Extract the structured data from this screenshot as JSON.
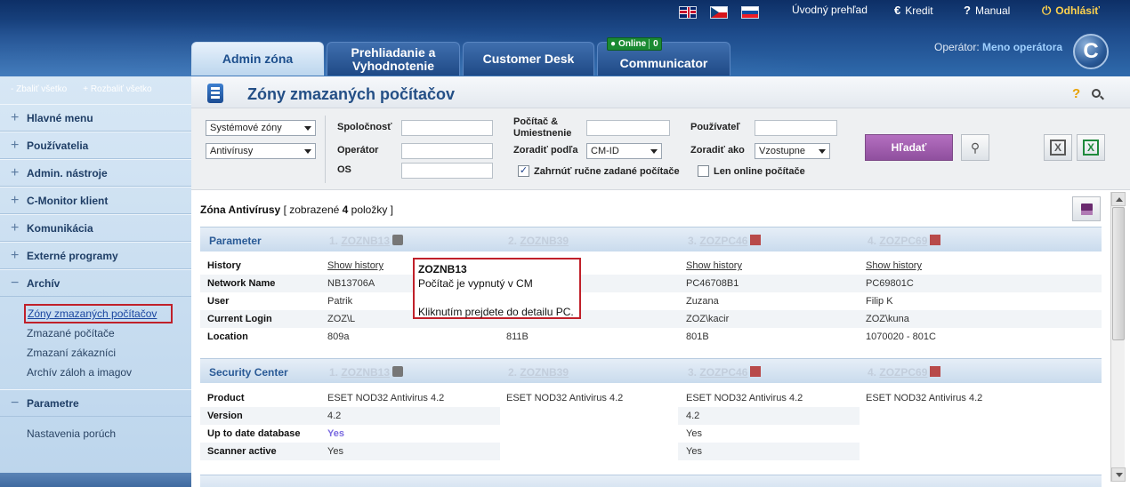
{
  "topbar": {
    "links": [
      {
        "icon": "",
        "label": "Úvodný prehľad"
      },
      {
        "icon": "€",
        "label": "Kredit"
      },
      {
        "icon": "?",
        "label": "Manual"
      },
      {
        "icon": "⏻",
        "label": "Odhlásiť"
      }
    ],
    "tabs": [
      "Admin zóna",
      "Prehliadanie a Vyhodnotenie",
      "Customer Desk",
      "Communicator"
    ],
    "online_label": "Online",
    "online_count": "0",
    "operator_label": "Operátor:",
    "operator_name": "Meno operátora",
    "logo_letter": "C"
  },
  "sidebar": {
    "collapse_all": "- Zbaliť všetko",
    "expand_all": "+ Rozbaliť všetko",
    "items": [
      {
        "sign": "+",
        "label": "Hlavné menu"
      },
      {
        "sign": "+",
        "label": "Používatelia"
      },
      {
        "sign": "+",
        "label": "Admin. nástroje"
      },
      {
        "sign": "+",
        "label": "C-Monitor klient"
      },
      {
        "sign": "+",
        "label": "Komunikácia"
      },
      {
        "sign": "+",
        "label": "Externé programy"
      },
      {
        "sign": "−",
        "label": "Archív"
      }
    ],
    "archiv_sub": [
      "Zóny zmazaných počítačov",
      "Zmazané počítače",
      "Zmazaní zákazníci",
      "Archív záloh a imagov"
    ],
    "param": {
      "sign": "−",
      "label": "Parametre"
    },
    "param_sub": [
      "Nastavenia porúch"
    ]
  },
  "main": {
    "title": "Zóny zmazaných počítačov",
    "help": "?",
    "filters": {
      "zone_select": "Systémové zóny",
      "type_select": "Antivírusy",
      "company_label": "Spoločnosť",
      "operator_label": "Operátor",
      "os_label": "OS",
      "pc_label": "Počítač & Umiestnenie",
      "sort_by_label": "Zoradiť podľa",
      "sort_by_value": "CM-ID",
      "user_label": "Používateľ",
      "sort_as_label": "Zoradiť ako",
      "sort_as_value": "Vzostupne",
      "manual_check": "✓",
      "manual_label": "Zahrnúť ručne zadané počítače",
      "online_label": "Len online počítače",
      "search_button": "Hľadať",
      "export_xls": "X",
      "export_xls2": "X"
    },
    "caption": {
      "zone": "Zóna Antivírusy",
      "pre": "[ zobrazené ",
      "count": "4",
      "post": " položky ]"
    },
    "computers": [
      {
        "num": "1.",
        "name": "ZOZNB13"
      },
      {
        "num": "2.",
        "name": "ZOZNB39"
      },
      {
        "num": "3.",
        "name": "ZOZPC46"
      },
      {
        "num": "4.",
        "name": "ZOZPC69"
      }
    ],
    "sections": [
      {
        "name": "Parameter",
        "rows": [
          {
            "label": "History",
            "values": [
              "Show history",
              "",
              "Show history",
              "Show history"
            ]
          },
          {
            "label": "Network Name",
            "values": [
              "NB13706A",
              "",
              "PC46708B1",
              "PC69801C"
            ]
          },
          {
            "label": "User",
            "values": [
              "Patrik",
              "",
              "Zuzana",
              "Filip K"
            ]
          },
          {
            "label": "Current Login",
            "values": [
              "ZOZ\\L",
              "",
              "ZOZ\\kacir",
              "ZOZ\\kuna"
            ]
          },
          {
            "label": "Location",
            "values": [
              "809a",
              "811B",
              "801B",
              "1070020 - 801C"
            ]
          }
        ]
      },
      {
        "name": "Security Center",
        "rows": [
          {
            "label": "Product",
            "values": [
              "ESET NOD32 Antivirus 4.2",
              "ESET NOD32 Antivirus 4.2",
              "ESET NOD32 Antivirus 4.2",
              "ESET NOD32 Antivirus 4.2"
            ]
          },
          {
            "label": "Version",
            "values": [
              "4.2",
              "",
              "4.2",
              ""
            ]
          },
          {
            "label": "Up to date database",
            "values": [
              "Yes",
              "",
              "Yes",
              ""
            ]
          },
          {
            "label": "Scanner active",
            "values": [
              "Yes",
              "",
              "Yes",
              ""
            ]
          }
        ]
      }
    ],
    "tooltip": {
      "title": "ZOZNB13",
      "line1": "Počítač je vypnutý v CM",
      "line2": "Kliknutím prejdete do detailu PC."
    }
  },
  "colors": {
    "accent": "#244f86",
    "highlight": "#c0202a",
    "search_button": "#a35fb0"
  }
}
